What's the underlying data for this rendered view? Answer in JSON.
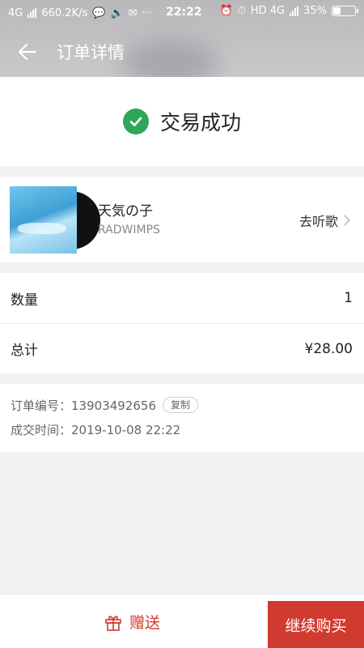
{
  "status_bar": {
    "network_left": "4G",
    "speed": "660.2K/s",
    "more": "···",
    "time": "22:22",
    "network_right": "HD 4G",
    "battery": "35%",
    "battery_level": 0.35
  },
  "header": {
    "title": "订单详情"
  },
  "success": {
    "text": "交易成功",
    "accent": "#2fa65a"
  },
  "album": {
    "name": "天気の子",
    "artist": "RADWIMPS",
    "listen_label": "去听歌"
  },
  "summary": {
    "quantity_label": "数量",
    "quantity_value": "1",
    "total_label": "总计",
    "total_value": "¥28.00"
  },
  "order": {
    "number_label": "订单编号：",
    "number": "13903492656",
    "copy_label": "复制",
    "time_label": "成交时间：",
    "time": "2019-10-08 22:22"
  },
  "bottom": {
    "gift_label": "赠送",
    "buy_label": "继续购买",
    "accent": "#d13a2f"
  }
}
